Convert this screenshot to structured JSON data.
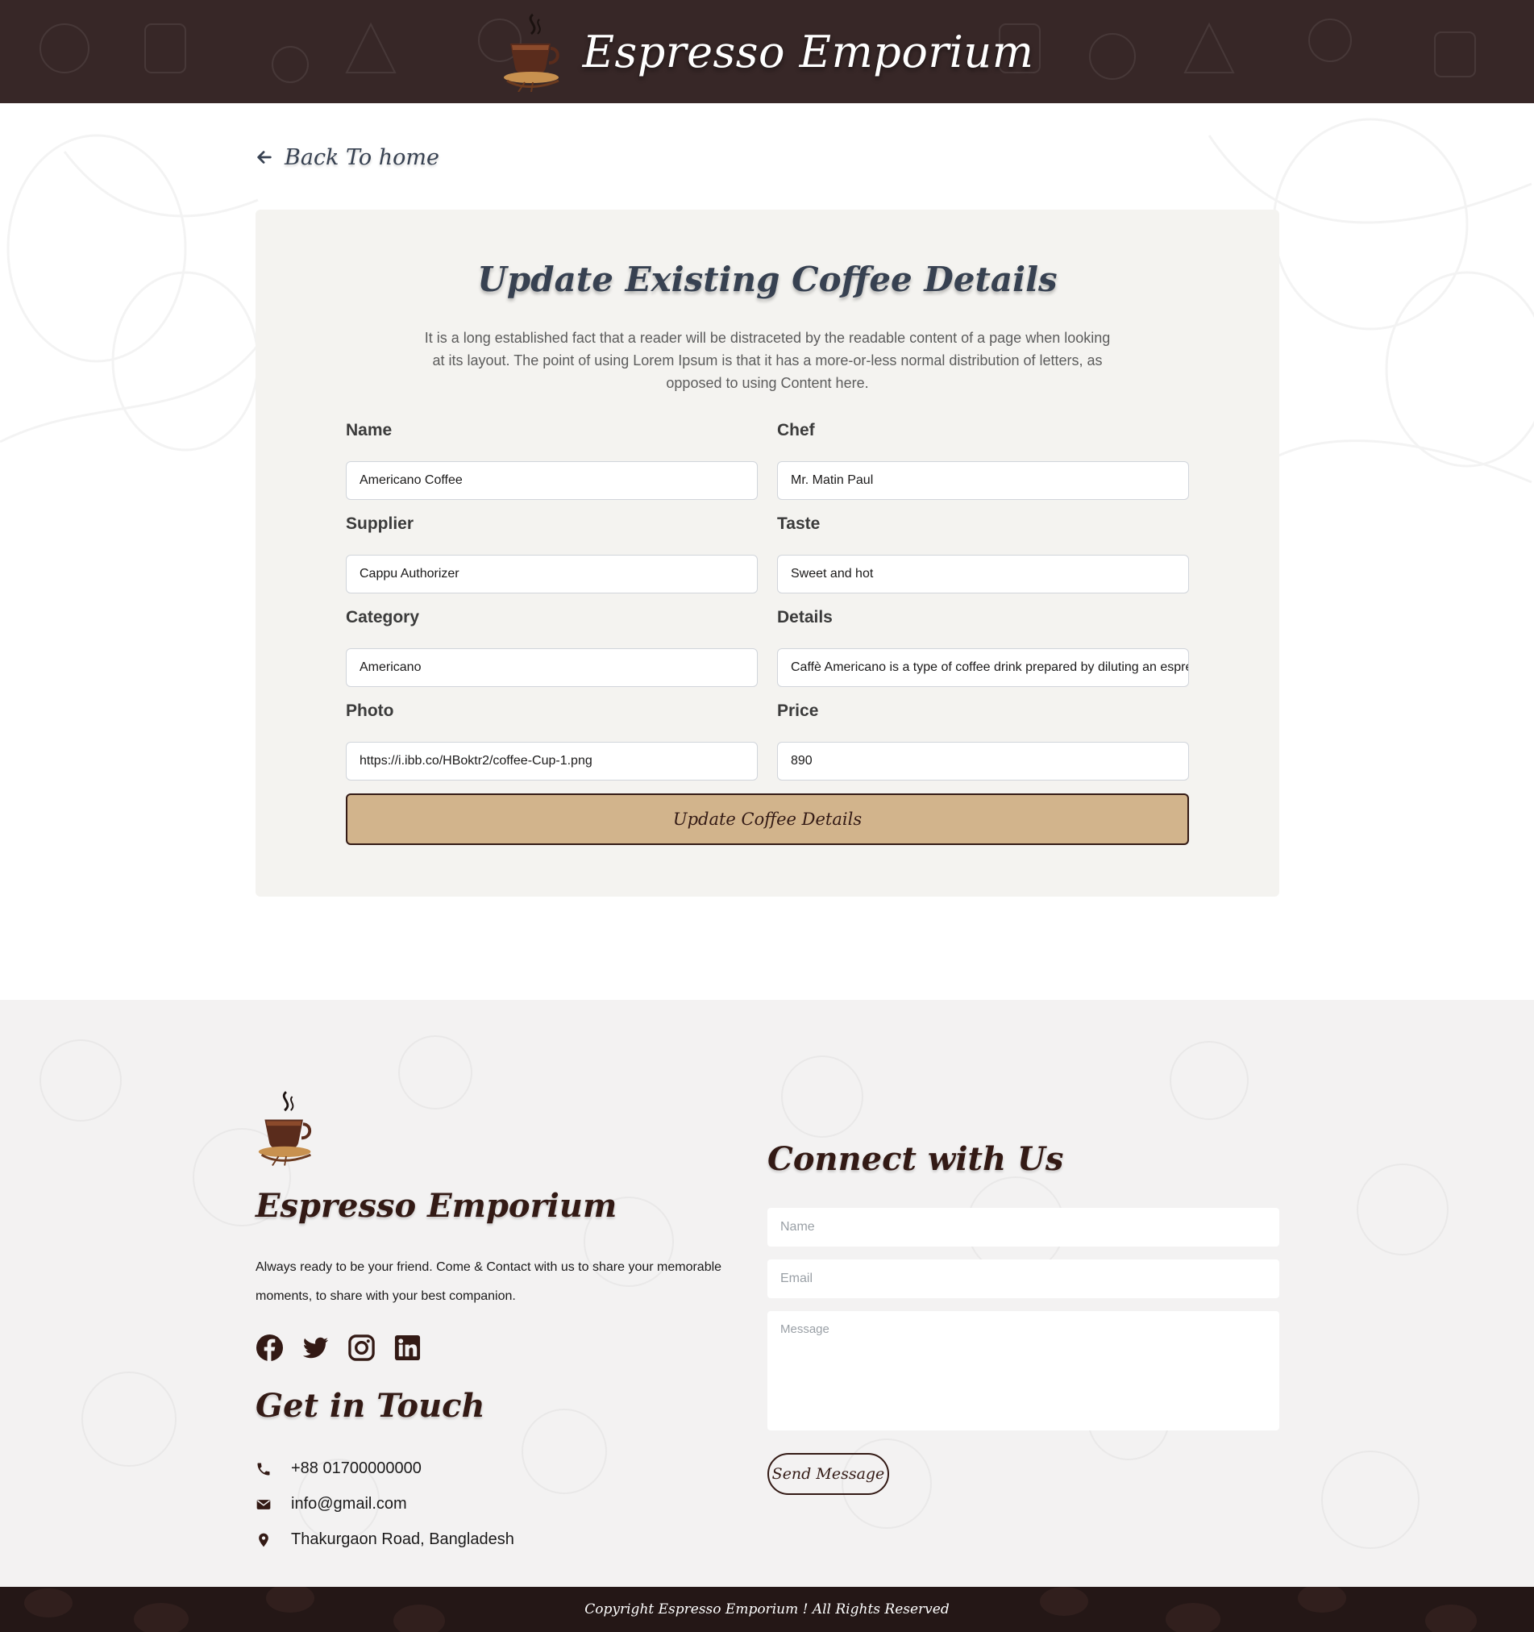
{
  "header": {
    "brand_title": "Espresso Emporium",
    "logo_icon": "coffee-cup-logo-icon"
  },
  "back_link": {
    "label": "Back To home",
    "icon": "arrow-left-icon"
  },
  "form": {
    "title": "Update Existing Coffee Details",
    "description": "It is a long established fact that a reader will be distraceted by the readable content of a page when looking at its layout. The point of using Lorem Ipsum is that it has a more-or-less normal distribution of letters, as opposed to using Content here.",
    "fields": {
      "name": {
        "label": "Name",
        "value": "Americano Coffee"
      },
      "chef": {
        "label": "Chef",
        "value": "Mr. Matin Paul"
      },
      "supplier": {
        "label": "Supplier",
        "value": "Cappu Authorizer"
      },
      "taste": {
        "label": "Taste",
        "value": "Sweet and hot"
      },
      "category": {
        "label": "Category",
        "value": "Americano"
      },
      "details": {
        "label": "Details",
        "value": "Caffè Americano is a type of coffee drink prepared by diluting an espresso with hot water"
      },
      "photo": {
        "label": "Photo",
        "value": "https://i.ibb.co/HBoktr2/coffee-Cup-1.png"
      },
      "price": {
        "label": "Price",
        "value": "890"
      }
    },
    "submit_label": "Update Coffee Details"
  },
  "footer": {
    "brand_title": "Espresso Emporium",
    "description": "Always ready to be your friend. Come & Contact with us to share your memorable moments, to share with your best companion.",
    "socials": [
      "facebook-icon",
      "twitter-icon",
      "instagram-icon",
      "linkedin-icon"
    ],
    "get_in_touch_title": "Get in Touch",
    "contacts": {
      "phone": "+88 01700000000",
      "email": "info@gmail.com",
      "address": "Thakurgaon Road, Bangladesh"
    },
    "connect_title": "Connect with Us",
    "contact_form": {
      "name_placeholder": "Name",
      "email_placeholder": "Email",
      "message_placeholder": "Message",
      "send_label": "Send Message"
    }
  },
  "copyright": "Copyright Espresso Emporium ! All Rights Reserved",
  "colors": {
    "header_bg": "#372727",
    "accent": "#D2B48C",
    "dark_brown": "#331A15",
    "card_bg": "#F4F3F0"
  }
}
